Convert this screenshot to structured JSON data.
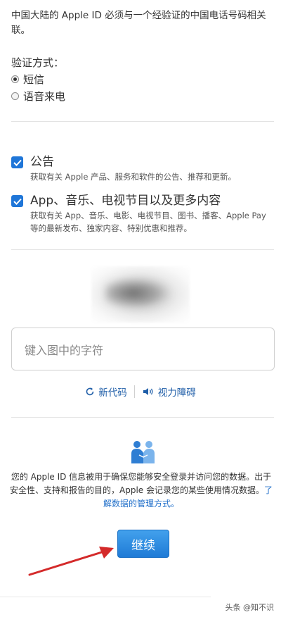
{
  "intro_text": "中国大陆的 Apple ID 必须与一个经验证的中国电话号码相关联。",
  "verify": {
    "title": "验证方式：",
    "options": [
      {
        "label": "短信",
        "selected": true
      },
      {
        "label": "语音来电",
        "selected": false
      }
    ]
  },
  "subscriptions": [
    {
      "title": "公告",
      "desc": "获取有关 Apple 产品、服务和软件的公告、推荐和更新。",
      "checked": true
    },
    {
      "title": "App、音乐、电视节目以及更多内容",
      "desc": "获取有关 App、音乐、电影、电视节目、图书、播客、Apple Pay 等的最新发布、独家内容、特别优惠和推荐。",
      "checked": true
    }
  ],
  "captcha": {
    "placeholder": "键入图中的字符",
    "new_code_label": "新代码",
    "vision_impaired_label": "视力障碍",
    "new_code_icon": "refresh-icon",
    "audio_icon": "speaker-icon"
  },
  "privacy": {
    "text": "您的 Apple ID 信息被用于确保您能够安全登录并访问您的数据。出于安全性、支持和报告的目的，Apple 会记录您的某些使用情况数据。",
    "link": "了解数据的管理方式。",
    "icon": "people-handshake-icon"
  },
  "continue_label": "继续",
  "watermark": "头条 @知不识",
  "colors": {
    "accent": "#1f76d8",
    "link": "#1f6ec9",
    "arrow": "#d42a2a"
  }
}
